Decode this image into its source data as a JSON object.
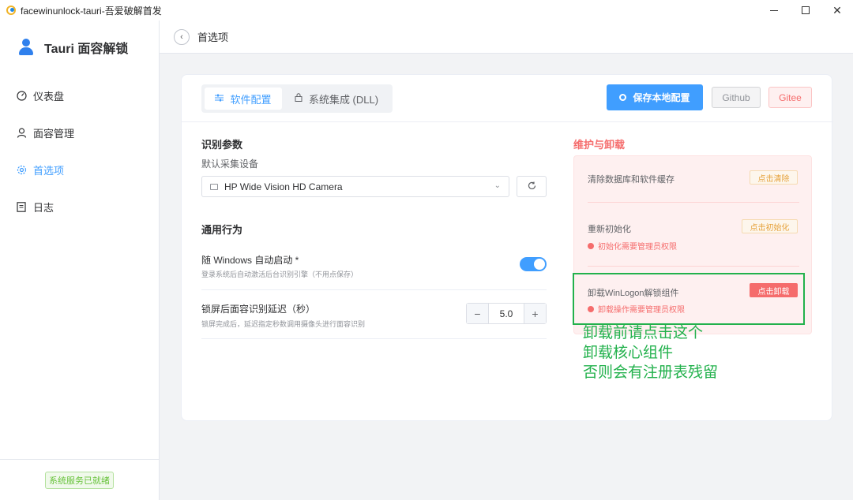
{
  "window": {
    "title": "facewinunlock-tauri-吾爱破解首发"
  },
  "sidebar": {
    "brand": "Tauri 面容解锁",
    "items": [
      {
        "label": "仪表盘",
        "icon": "dashboard-icon"
      },
      {
        "label": "面容管理",
        "icon": "user-icon"
      },
      {
        "label": "首选项",
        "icon": "gear-icon"
      },
      {
        "label": "日志",
        "icon": "document-icon"
      }
    ],
    "active_index": 2,
    "status": "系统服务已就绪"
  },
  "header": {
    "title": "首选项"
  },
  "tabs": [
    {
      "label": "软件配置",
      "icon": "sliders-icon",
      "active": true
    },
    {
      "label": "系统集成 (DLL)",
      "icon": "lock-icon",
      "active": false
    }
  ],
  "toolbar": {
    "save_label": "保存本地配置",
    "github_label": "Github",
    "gitee_label": "Gitee"
  },
  "recognition": {
    "section_title": "识别参数",
    "device_label": "默认采集设备",
    "device_value": "HP Wide Vision HD Camera"
  },
  "general": {
    "section_title": "通用行为",
    "autostart_title": "随 Windows 自动启动 *",
    "autostart_desc": "登录系统后自动激活后台识别引擎（不用点保存）",
    "autostart_enabled": true,
    "delay_title": "锁屏后面容识别延迟（秒）",
    "delay_desc": "锁屏完成后，延迟指定秒数调用摄像头进行面容识别",
    "delay_value": "5.0"
  },
  "maintenance": {
    "title": "维护与卸载",
    "clear_label": "清除数据库和软件缓存",
    "clear_button": "点击清除",
    "reinit_label": "重新初始化",
    "reinit_button": "点击初始化",
    "reinit_note": "初始化需要管理员权限",
    "uninstall_label": "卸载WinLogon解锁组件",
    "uninstall_button": "点击卸载",
    "uninstall_note": "卸载操作需要管理员权限"
  },
  "annotation": {
    "lines": [
      "卸载前请点击这个",
      "卸载核心组件",
      "否则会有注册表残留"
    ],
    "color": "#22b14c"
  },
  "colors": {
    "primary": "#409eff",
    "danger": "#f56c6c",
    "warning": "#e6a23c",
    "success": "#67c23a"
  }
}
